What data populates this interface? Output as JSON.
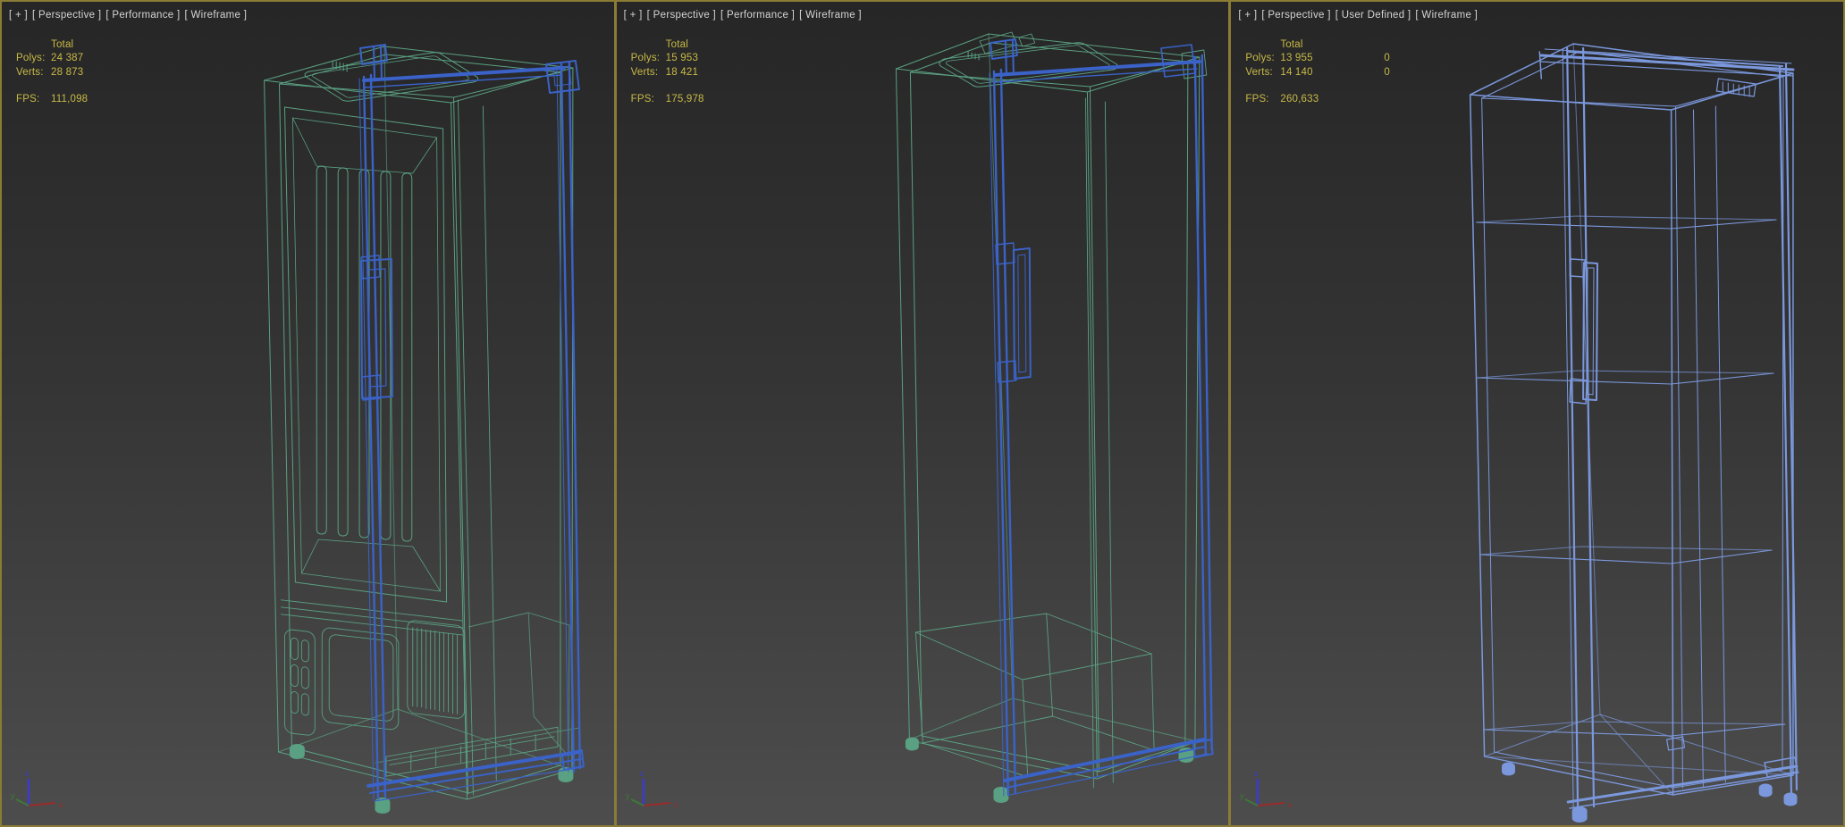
{
  "colors": {
    "frame": "#8a7b35",
    "bg_top": "#262626",
    "bg_bottom": "#4d4d4d",
    "header_text": "#d4d4d4",
    "stats_text": "#c9ba47",
    "wire_green": "#5aa082",
    "wire_blue": "#3a62c8",
    "wire_light_blue": "#7b98dd",
    "axis_x": "#9b2b2b",
    "axis_y": "#3c7a37",
    "axis_z": "#3b3bd0"
  },
  "axis_gizmo": {
    "x_label": "x",
    "y_label": "y",
    "z_label": "z"
  },
  "panels": [
    {
      "header": {
        "plus": "[ + ]",
        "viewpoint": "[ Perspective ]",
        "mode": "[ Performance ]",
        "shading": "[ Wireframe ]"
      },
      "stats": {
        "total_label": "Total",
        "polys_label": "Polys:",
        "polys_value": "24 387",
        "verts_label": "Verts:",
        "verts_value": "28 873",
        "fps_label": "FPS:",
        "fps_value": "111,098"
      }
    },
    {
      "header": {
        "plus": "[ + ]",
        "viewpoint": "[ Perspective ]",
        "mode": "[ Performance ]",
        "shading": "[ Wireframe ]"
      },
      "stats": {
        "total_label": "Total",
        "polys_label": "Polys:",
        "polys_value": "15 953",
        "verts_label": "Verts:",
        "verts_value": "18 421",
        "fps_label": "FPS:",
        "fps_value": "175,978"
      }
    },
    {
      "header": {
        "plus": "[ + ]",
        "viewpoint": "[ Perspective ]",
        "mode": "[ User Defined ]",
        "shading": "[ Wireframe ]"
      },
      "stats": {
        "total_label": "Total",
        "polys_label": "Polys:",
        "polys_value": "13 955",
        "polys_extra": "0",
        "verts_label": "Verts:",
        "verts_value": "14 140",
        "verts_extra": "0",
        "fps_label": "FPS:",
        "fps_value": "260,633"
      }
    }
  ]
}
